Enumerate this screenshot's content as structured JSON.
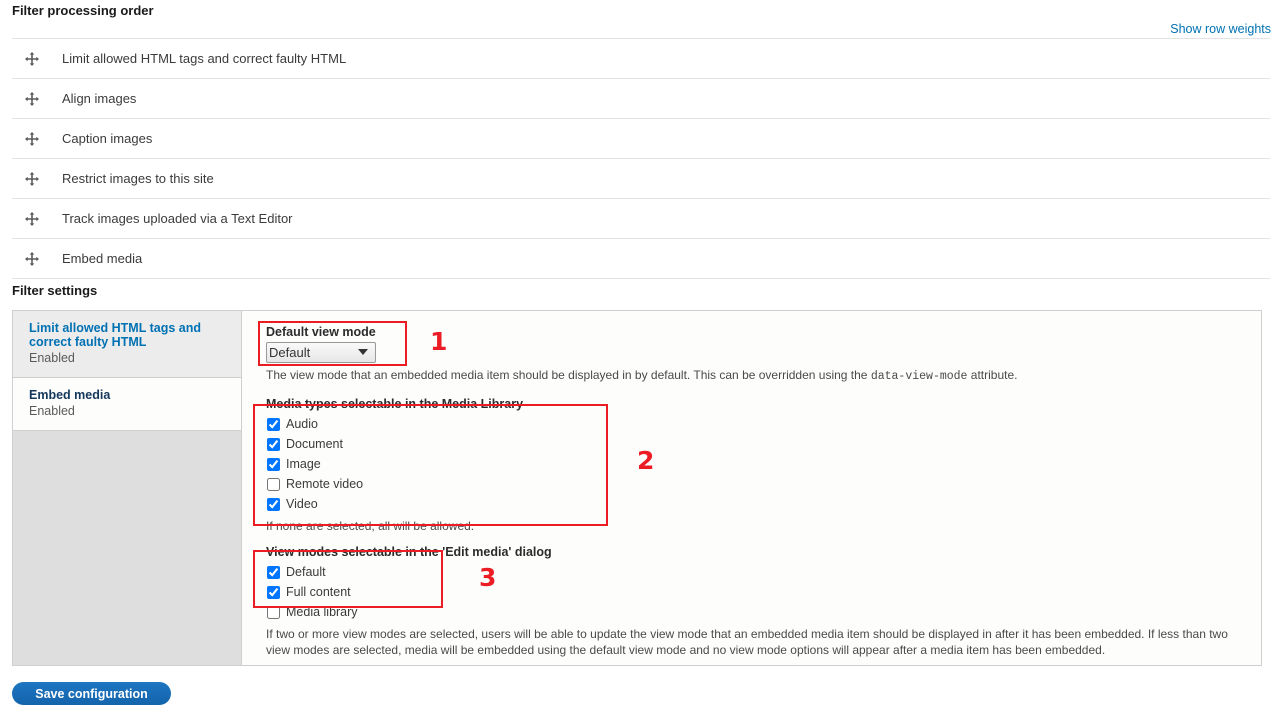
{
  "order_section": {
    "heading": "Filter processing order",
    "show_row_weights_label": "Show row weights",
    "rows": [
      {
        "name": "Limit allowed HTML tags and correct faulty HTML"
      },
      {
        "name": "Align images"
      },
      {
        "name": "Caption images"
      },
      {
        "name": "Restrict images to this site"
      },
      {
        "name": "Track images uploaded via a Text Editor"
      },
      {
        "name": "Embed media"
      }
    ]
  },
  "settings_section": {
    "heading": "Filter settings",
    "tabs": [
      {
        "title": "Limit allowed HTML tags and correct faulty HTML",
        "summary": "Enabled",
        "active": false
      },
      {
        "title": "Embed media",
        "summary": "Enabled",
        "active": true
      }
    ],
    "pane": {
      "default_view_mode": {
        "label": "Default view mode",
        "selected": "Default",
        "options": [
          "Default",
          "Full content",
          "Media library"
        ],
        "description_before": "The view mode that an embedded media item should be displayed in by default. This can be overridden using the ",
        "description_code": "data-view-mode",
        "description_after": " attribute."
      },
      "media_types": {
        "label": "Media types selectable in the Media Library",
        "items": [
          {
            "label": "Audio",
            "checked": true
          },
          {
            "label": "Document",
            "checked": true
          },
          {
            "label": "Image",
            "checked": true
          },
          {
            "label": "Remote video",
            "checked": false
          },
          {
            "label": "Video",
            "checked": true
          }
        ],
        "description": "If none are selected, all will be allowed."
      },
      "view_modes": {
        "label": "View modes selectable in the 'Edit media' dialog",
        "items": [
          {
            "label": "Default",
            "checked": true
          },
          {
            "label": "Full content",
            "checked": true
          },
          {
            "label": "Media library",
            "checked": false
          }
        ],
        "description": "If two or more view modes are selected, users will be able to update the view mode that an embedded media item should be displayed in after it has been embedded. If less than two view modes are selected, media will be embedded using the default view mode and no view mode options will appear after a media item has been embedded."
      }
    }
  },
  "footer": {
    "save_label": "Save configuration"
  },
  "annotations": [
    {
      "number": "1"
    },
    {
      "number": "2"
    },
    {
      "number": "3"
    }
  ],
  "colors": {
    "link": "#0071b3",
    "annotation_red": "#ec1c24",
    "button_blue": "#1364ab",
    "active_tab_title": "#14385b"
  }
}
